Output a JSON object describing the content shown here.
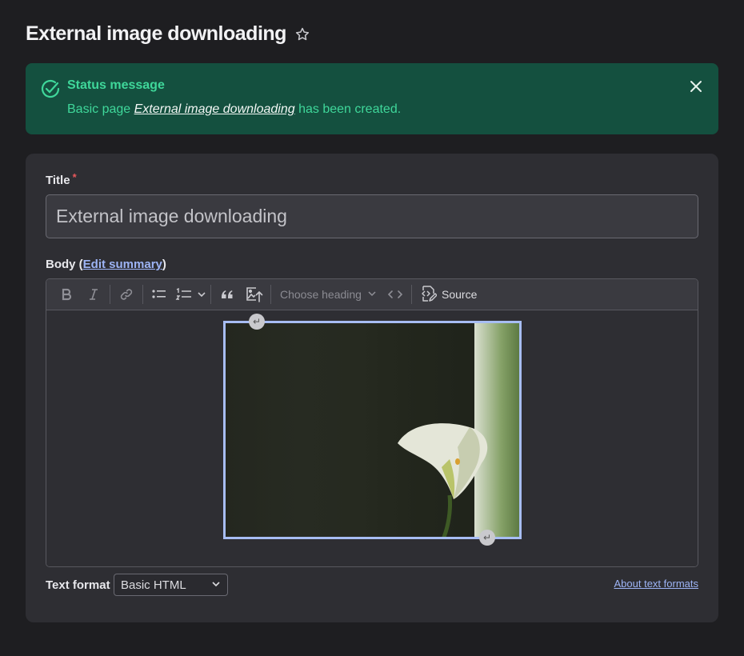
{
  "page": {
    "title": "External image downloading"
  },
  "status": {
    "heading": "Status message",
    "text_before": "Basic page ",
    "link_text": "External image downloading",
    "text_after": " has been created.",
    "accent": "#3fd79a",
    "background": "#14503f"
  },
  "form": {
    "title_label": "Title",
    "required_mark": "*",
    "title_value": "External image downloading",
    "body_label_prefix": "Body (",
    "edit_summary_link": "Edit summary",
    "body_label_suffix": ")",
    "toolbar": {
      "heading_placeholder": "Choose heading",
      "source_label": "Source",
      "buttons": [
        "bold-icon",
        "italic-icon",
        "link-icon",
        "bulleted-list-icon",
        "numbered-list-icon",
        "blockquote-icon",
        "insert-image-icon",
        "code-block-icon",
        "source-icon"
      ]
    },
    "text_format_label": "Text format",
    "text_format_value": "Basic HTML",
    "about_text_formats": "About text formats"
  }
}
